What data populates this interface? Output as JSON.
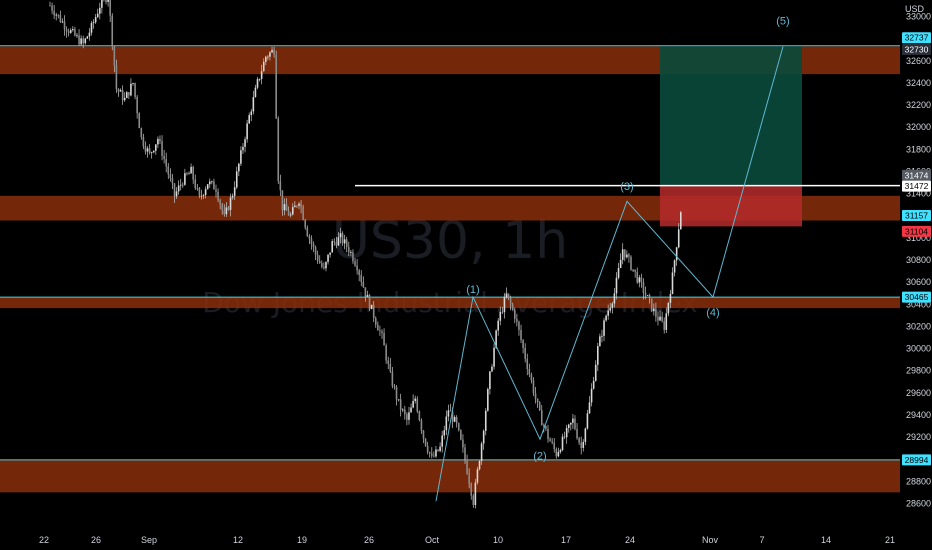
{
  "chart_data": {
    "type": "candlestick",
    "symbol": "US30, 1h",
    "description": "Dow Jones Industrial Average Index",
    "currency": "USD",
    "ylim": [
      28450,
      33150
    ],
    "y_ticks": [
      33000,
      32800,
      32600,
      32400,
      32200,
      32000,
      31800,
      31600,
      31400,
      31200,
      31000,
      30800,
      30600,
      30400,
      30200,
      30000,
      29800,
      29600,
      29400,
      29200,
      29000,
      28800,
      28600
    ],
    "x_ticks": [
      "22",
      "26",
      "Sep",
      "12",
      "19",
      "26",
      "Oct",
      "10",
      "17",
      "24",
      "Nov",
      "7",
      "14",
      "21"
    ],
    "price_path": [
      [
        0,
        33100
      ],
      [
        2,
        32900
      ],
      [
        4,
        32750
      ],
      [
        5,
        32900
      ],
      [
        6,
        33100
      ],
      [
        7,
        33200
      ],
      [
        8,
        32350
      ],
      [
        9,
        32250
      ],
      [
        10,
        32400
      ],
      [
        11,
        31900
      ],
      [
        12,
        31750
      ],
      [
        13,
        31900
      ],
      [
        14,
        31650
      ],
      [
        15,
        31380
      ],
      [
        16,
        31520
      ],
      [
        17,
        31600
      ],
      [
        18,
        31350
      ],
      [
        19,
        31500
      ],
      [
        20,
        31450
      ],
      [
        21,
        31180
      ],
      [
        22,
        31400
      ],
      [
        23,
        31750
      ],
      [
        24,
        32100
      ],
      [
        25,
        32400
      ],
      [
        26,
        32640
      ],
      [
        27,
        32700
      ],
      [
        27.5,
        31550
      ],
      [
        28,
        31280
      ],
      [
        29,
        31200
      ],
      [
        30,
        31350
      ],
      [
        31,
        31050
      ],
      [
        32,
        30850
      ],
      [
        33,
        30700
      ],
      [
        34,
        30950
      ],
      [
        35,
        31000
      ],
      [
        36,
        30900
      ],
      [
        37,
        30750
      ],
      [
        38,
        30500
      ],
      [
        39,
        30300
      ],
      [
        40,
        30100
      ],
      [
        41,
        29750
      ],
      [
        42,
        29500
      ],
      [
        43,
        29350
      ],
      [
        44,
        29550
      ],
      [
        45,
        29200
      ],
      [
        46,
        29000
      ],
      [
        47,
        29100
      ],
      [
        48,
        29450
      ],
      [
        49,
        29300
      ],
      [
        50,
        29000
      ],
      [
        51,
        28620
      ],
      [
        52,
        29150
      ],
      [
        53,
        29750
      ],
      [
        54,
        30250
      ],
      [
        55,
        30480
      ],
      [
        56,
        30300
      ],
      [
        57,
        30000
      ],
      [
        58,
        29700
      ],
      [
        59,
        29400
      ],
      [
        60,
        29200
      ],
      [
        61,
        29050
      ],
      [
        62,
        29200
      ],
      [
        63,
        29350
      ],
      [
        64,
        29100
      ],
      [
        65,
        29500
      ],
      [
        66,
        30000
      ],
      [
        67,
        30300
      ],
      [
        68,
        30500
      ],
      [
        69,
        30900
      ],
      [
        70,
        30750
      ],
      [
        71,
        30600
      ],
      [
        72,
        30450
      ],
      [
        73,
        30300
      ],
      [
        74,
        30200
      ],
      [
        75,
        30650
      ],
      [
        76,
        31250
      ]
    ],
    "total_bars": 76,
    "horizontal_levels": [
      32737,
      30465,
      28994
    ],
    "level_tags": [
      "32737",
      "30465",
      "28994"
    ],
    "zones": [
      {
        "low": 32480,
        "high": 32730
      },
      {
        "low": 31157,
        "high": 31380
      },
      {
        "low": 30365,
        "high": 30465
      },
      {
        "low": 28700,
        "high": 28994
      }
    ],
    "resistance_line": 31472,
    "position": {
      "entry": 31474,
      "stop": 31104,
      "target": 32730
    },
    "price_tags": {
      "target": "32730",
      "entry": "31474",
      "line": "31472",
      "mid": "31157",
      "stop": "31104"
    },
    "waves": [
      {
        "label": "(1)",
        "price": 30465
      },
      {
        "label": "(2)",
        "price": 29050
      },
      {
        "label": "(3)",
        "price": 31380
      },
      {
        "label": "(4)",
        "price": 30465
      },
      {
        "label": "(5)",
        "price": 32900
      }
    ],
    "colors": {
      "zone": "#8a2e0b",
      "level_line": "#4dd0e1",
      "profit": "#0a4a3c",
      "stop": "#8b1e1e",
      "wave": "#5fb7d0",
      "candle": "#c8c8c8",
      "tag_cyan": "#40e0ff",
      "tag_red": "#f23645",
      "tag_grey": "#555a63"
    }
  }
}
